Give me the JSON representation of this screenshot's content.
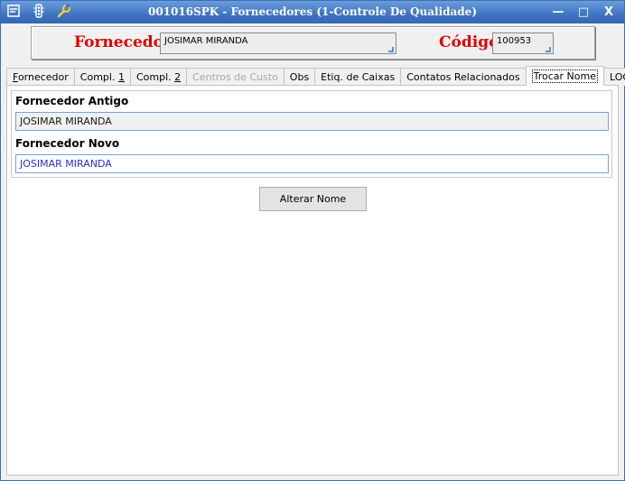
{
  "window": {
    "title": "001016SPK - Fornecedores (1-Controle De Qualidade)",
    "controls": {
      "minimize": "—",
      "maximize": "□",
      "close": "X"
    },
    "icons": [
      "menu-icon",
      "traffic-light-icon",
      "wrench-icon"
    ]
  },
  "header": {
    "fornecedor_label": "Fornecedor",
    "fornecedor_value": "JOSIMAR MIRANDA",
    "codigo_label": "Código",
    "codigo_value": "100953"
  },
  "tabs": [
    {
      "label": "Fornecedor",
      "state": "normal"
    },
    {
      "label": "Compl. 1",
      "state": "normal"
    },
    {
      "label": "Compl. 2",
      "state": "normal"
    },
    {
      "label": "Centros de Custo",
      "state": "disabled"
    },
    {
      "label": "Obs",
      "state": "normal"
    },
    {
      "label": "Etiq. de Caixas",
      "state": "normal"
    },
    {
      "label": "Contatos Relacionados",
      "state": "normal"
    },
    {
      "label": "Trocar Nome",
      "state": "active"
    },
    {
      "label": "LOG",
      "state": "normal"
    }
  ],
  "form": {
    "old_label": "Fornecedor Antigo",
    "old_value": "JOSIMAR MIRANDA",
    "new_label": "Fornecedor Novo",
    "new_value": "JOSIMAR MIRANDA"
  },
  "actions": {
    "rename_button": "Alterar Nome"
  },
  "colors": {
    "title_bar": "#3f74c2",
    "header_label": "#e00000",
    "new_value_text": "#2b2bd6"
  }
}
